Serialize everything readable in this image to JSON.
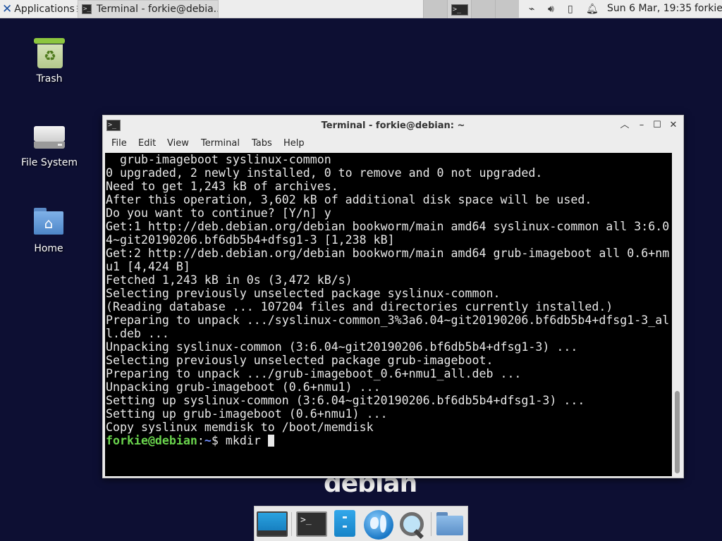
{
  "panel": {
    "apps_label": "Applications",
    "task_label": "Terminal - forkie@debia...",
    "clock": "Sun  6 Mar, 19:35",
    "user": "forkie"
  },
  "desktop": {
    "icons": [
      {
        "label": "Trash"
      },
      {
        "label": "File System"
      },
      {
        "label": "Home"
      }
    ],
    "logo_text": "debian"
  },
  "window": {
    "title": "Terminal - forkie@debian: ~",
    "menu": [
      "File",
      "Edit",
      "View",
      "Terminal",
      "Tabs",
      "Help"
    ]
  },
  "terminal": {
    "lines": [
      "  grub-imageboot syslinux-common",
      "0 upgraded, 2 newly installed, 0 to remove and 0 not upgraded.",
      "Need to get 1,243 kB of archives.",
      "After this operation, 3,602 kB of additional disk space will be used.",
      "Do you want to continue? [Y/n] y",
      "Get:1 http://deb.debian.org/debian bookworm/main amd64 syslinux-common all 3:6.0",
      "4~git20190206.bf6db5b4+dfsg1-3 [1,238 kB]",
      "Get:2 http://deb.debian.org/debian bookworm/main amd64 grub-imageboot all 0.6+nm",
      "u1 [4,424 B]",
      "Fetched 1,243 kB in 0s (3,472 kB/s)",
      "Selecting previously unselected package syslinux-common.",
      "(Reading database ... 107204 files and directories currently installed.)",
      "Preparing to unpack .../syslinux-common_3%3a6.04~git20190206.bf6db5b4+dfsg1-3_al",
      "l.deb ...",
      "Unpacking syslinux-common (3:6.04~git20190206.bf6db5b4+dfsg1-3) ...",
      "Selecting previously unselected package grub-imageboot.",
      "Preparing to unpack .../grub-imageboot_0.6+nmu1_all.deb ...",
      "Unpacking grub-imageboot (0.6+nmu1) ...",
      "Setting up syslinux-common (3:6.04~git20190206.bf6db5b4+dfsg1-3) ...",
      "Setting up grub-imageboot (0.6+nmu1) ...",
      "Copy syslinux memdisk to /boot/memdisk"
    ],
    "prompt_user": "forkie@debian",
    "prompt_sep": ":",
    "prompt_path": "~",
    "prompt_sym": "$ ",
    "command": "mkdir "
  },
  "colors": {
    "desktop_bg": "#0d0f33",
    "prompt_user": "#6ad44d",
    "prompt_path": "#6f8dff"
  }
}
